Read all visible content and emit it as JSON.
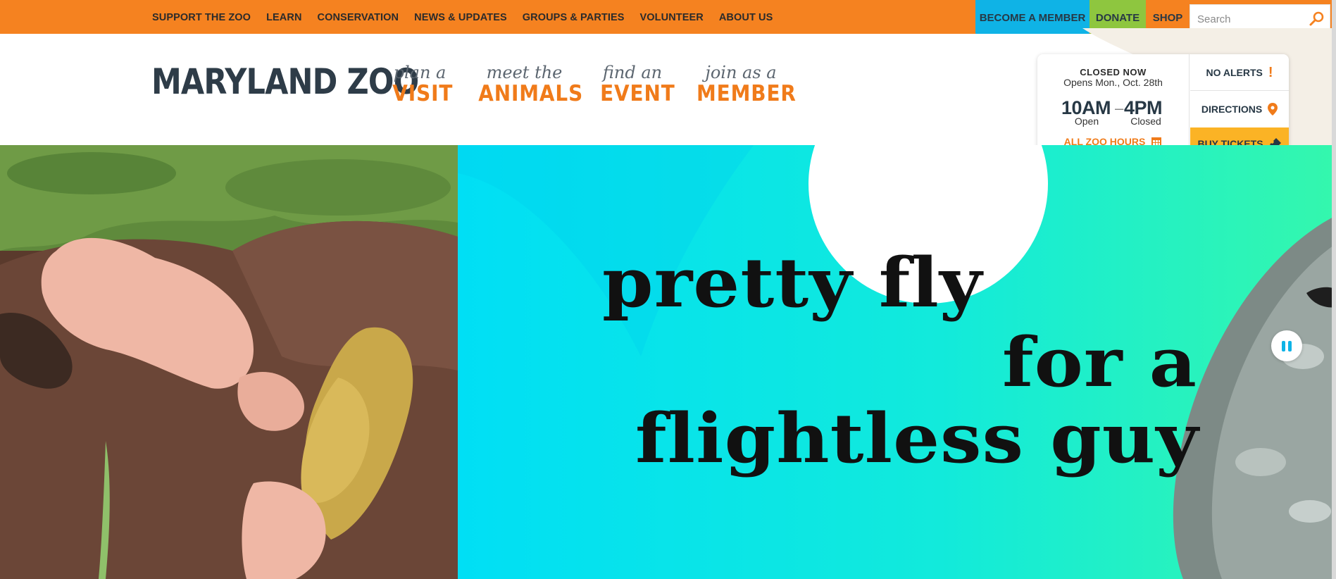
{
  "top_nav": {
    "links": [
      "SUPPORT THE ZOO",
      "LEARN",
      "CONSERVATION",
      "NEWS & UPDATES",
      "GROUPS & PARTIES",
      "VOLUNTEER",
      "ABOUT US"
    ]
  },
  "utility": {
    "member_label": "BECOME A MEMBER",
    "donate_label": "DONATE",
    "shop_label": "SHOP",
    "search_placeholder": "Search"
  },
  "logo": {
    "text": "MARYLAND ZOO"
  },
  "main_nav": [
    {
      "small": "plan a",
      "big": "VISIT"
    },
    {
      "small": "meet the",
      "big": "ANIMALS"
    },
    {
      "small": "find an",
      "big": "EVENT"
    },
    {
      "small": "join as a",
      "big": "MEMBER"
    }
  ],
  "hours_card": {
    "status": "CLOSED NOW",
    "opens": "Opens Mon., Oct. 28th",
    "open_time": "10AM",
    "dash": "–",
    "close_time": "4PM",
    "open_label": "Open",
    "close_label": "Closed",
    "all_hours_label": "ALL ZOO HOURS"
  },
  "side_buttons": {
    "alerts": "NO ALERTS",
    "directions": "DIRECTIONS",
    "tickets": "BUY TICKETS"
  },
  "hero": {
    "line1": "pretty fly",
    "line2": "for a",
    "line3": "flightless guy"
  },
  "colors": {
    "brand_orange": "#f58220",
    "member_blue": "#0fb3e6",
    "donate_green": "#8ec63f",
    "tickets_yellow": "#fbb325",
    "hero_cyan": "#00e4f2",
    "hero_mint": "#2ff5b0",
    "navy": "#273845"
  },
  "icons": [
    "search-icon",
    "alert-icon",
    "map-pin-icon",
    "calendar-icon",
    "ticket-icon",
    "pause-icon"
  ]
}
